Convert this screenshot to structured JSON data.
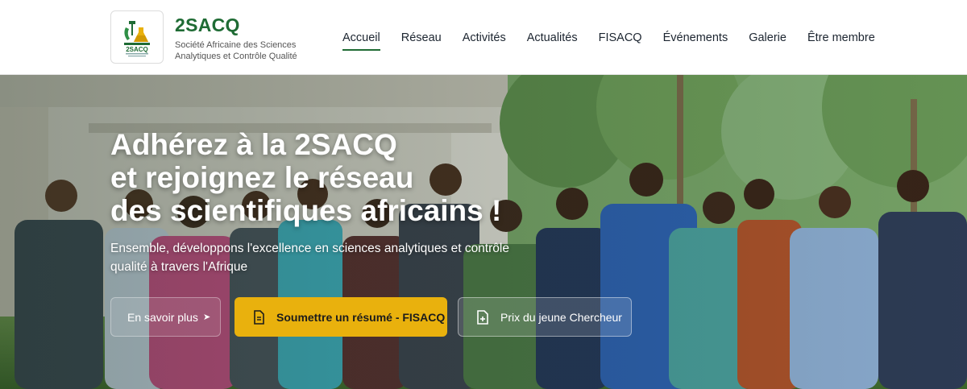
{
  "brand": {
    "logo_text": "2SACQ",
    "name": "2SACQ",
    "tagline": "Société Africaine des Sciences Analytiques et Contrôle Qualité"
  },
  "nav": {
    "items": [
      {
        "label": "Accueil",
        "active": true
      },
      {
        "label": "Réseau"
      },
      {
        "label": "Activités"
      },
      {
        "label": "Actualités"
      },
      {
        "label": "FISACQ"
      },
      {
        "label": "Événements"
      },
      {
        "label": "Galerie"
      },
      {
        "label": "Être membre"
      }
    ]
  },
  "hero": {
    "title_lines": [
      "Adhérez à la 2SACQ",
      "et rejoignez le réseau",
      "des scientifiques africains !"
    ],
    "subtitle": "Ensemble, développons l'excellence en sciences analytiques et contrôle qualité à travers l'Afrique",
    "buttons": {
      "learn_more": "En savoir plus",
      "submit_abstract": "Soumettre un résumé - FISACQ",
      "young_researcher": "Prix du jeune Chercheur"
    }
  },
  "colors": {
    "brand_green": "#1f6b34",
    "accent_yellow": "#e9b10d"
  }
}
